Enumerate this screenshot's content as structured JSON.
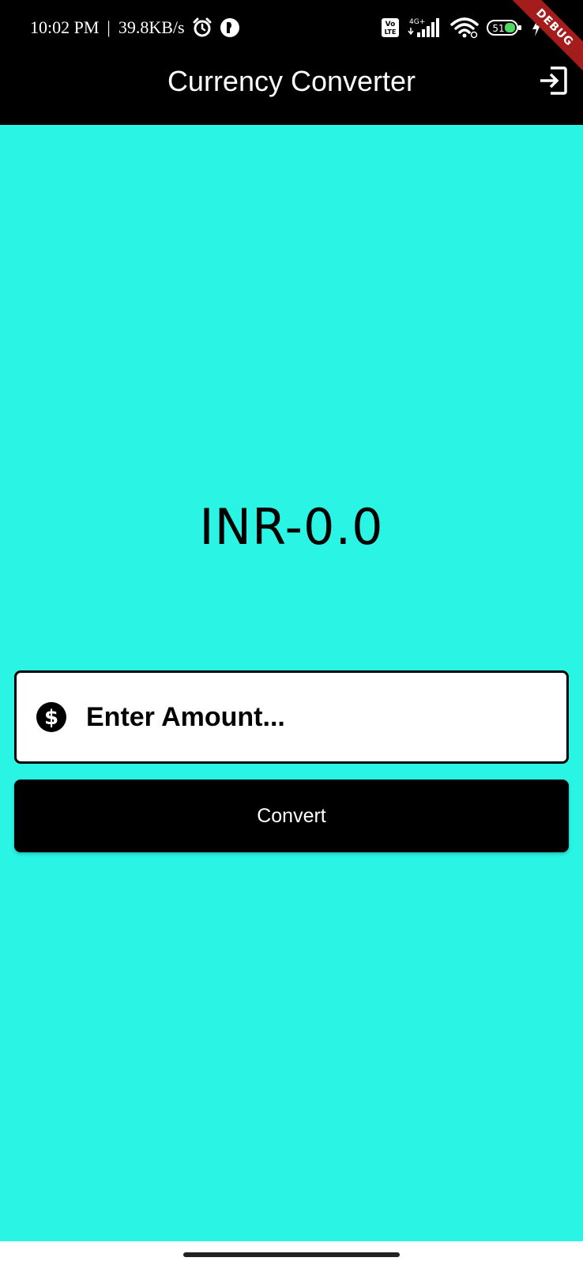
{
  "status_bar": {
    "time": "10:02 PM",
    "separator": "|",
    "network_speed": "39.8KB/s",
    "battery_level": "51",
    "icons": [
      "alarm-icon",
      "app-notification-icon",
      "volte-icon",
      "signal-icon",
      "wifi-icon",
      "battery-icon",
      "charging-icon"
    ],
    "network_type": "4G+",
    "volte_label_top": "Vo",
    "volte_label_bottom": "LTE"
  },
  "debug_banner": {
    "label": "DEBUG"
  },
  "app_bar": {
    "title": "Currency Converter",
    "action_icon": "logout-icon"
  },
  "main": {
    "result_text": "INR-0.0",
    "amount_field": {
      "placeholder": "Enter Amount...",
      "value": "",
      "prefix_icon": "dollar-circle-icon"
    },
    "convert_button_label": "Convert"
  },
  "colors": {
    "background": "#2af5e5",
    "app_bar": "#000000",
    "button": "#000000",
    "button_text": "#ffffff",
    "debug_ribbon": "#a51c1c"
  }
}
